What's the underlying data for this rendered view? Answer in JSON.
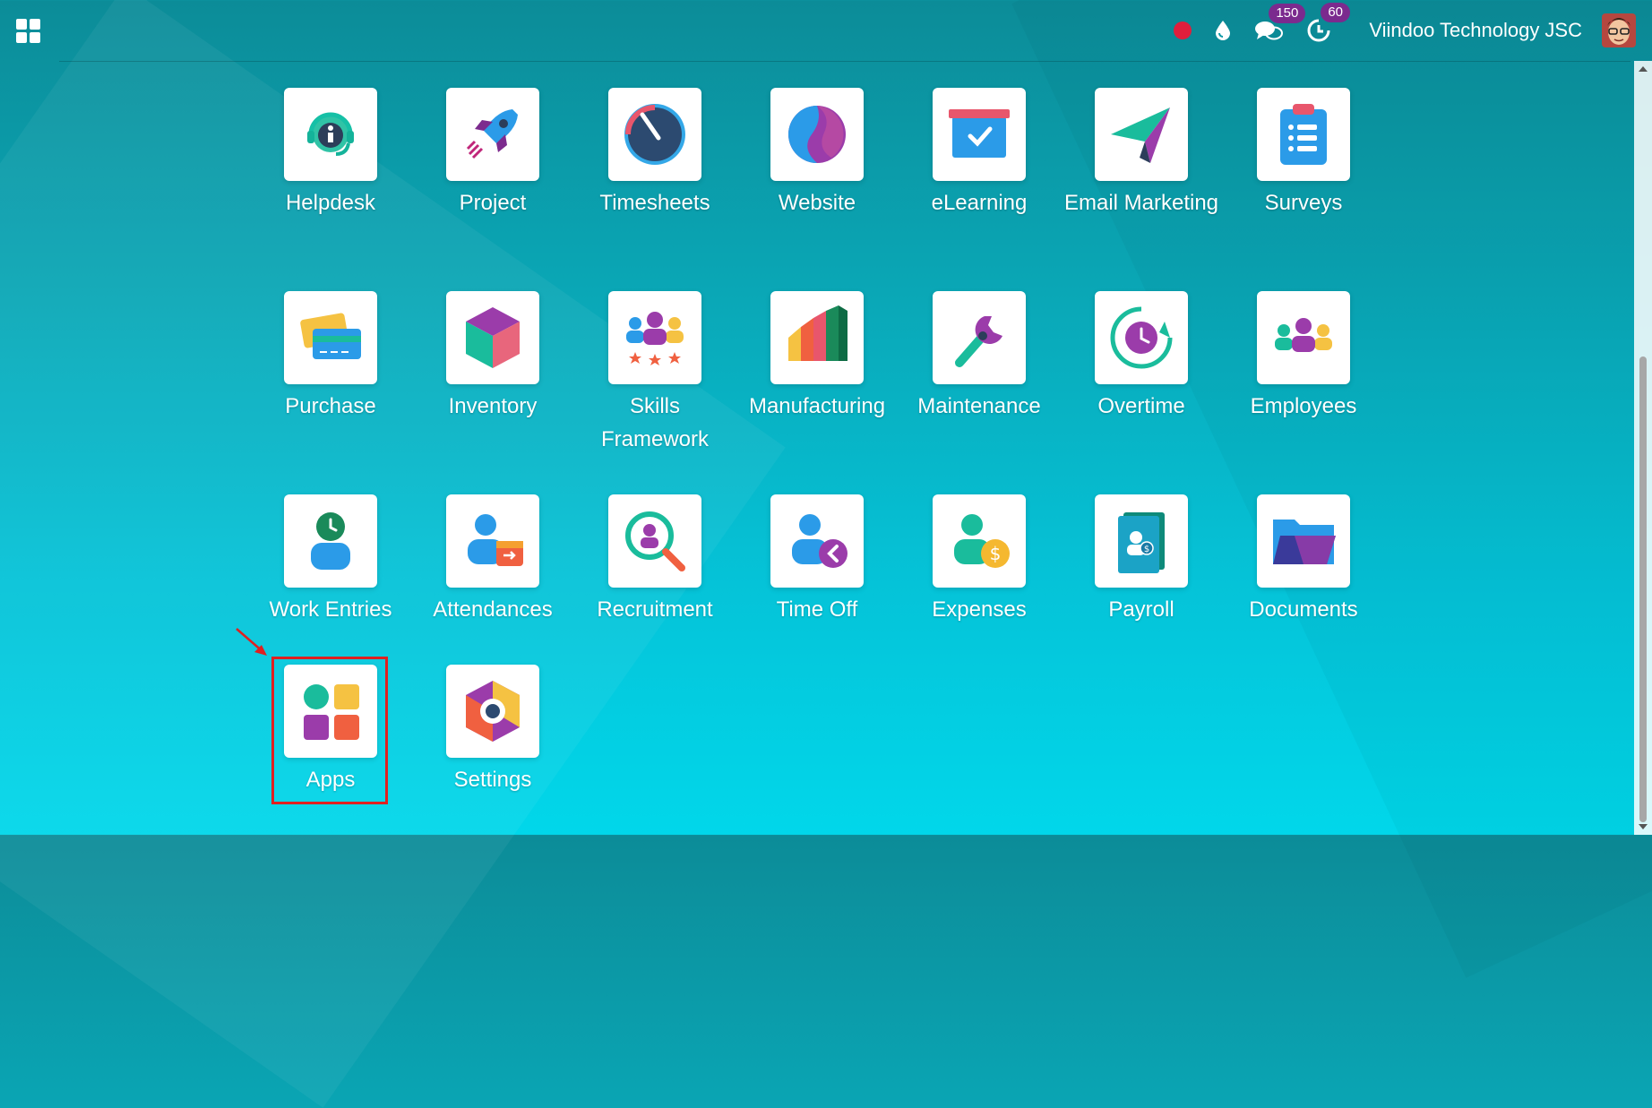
{
  "navbar": {
    "menu_icon": "apps-grid-icon",
    "record_icon": "record-dot-icon",
    "odoobot_icon": "droplet-icon",
    "messages": {
      "icon": "chat-bubbles-icon",
      "count": "150"
    },
    "activities": {
      "icon": "clock-icon",
      "count": "60"
    },
    "company": "Viindoo Technology JSC",
    "avatar_icon": "user-avatar-icon"
  },
  "colors": {
    "badge": "#7b2a8e",
    "record_dot": "#e01e3c",
    "highlight": "#e02020",
    "background_top": "#0c8c98",
    "background_bottom": "#01d7ea"
  },
  "apps": [
    {
      "label": "Helpdesk",
      "icon": "helpdesk-icon"
    },
    {
      "label": "Project",
      "icon": "rocket-icon"
    },
    {
      "label": "Timesheets",
      "icon": "gauge-icon"
    },
    {
      "label": "Website",
      "icon": "website-icon"
    },
    {
      "label": "eLearning",
      "icon": "elearning-icon"
    },
    {
      "label": "Email Marketing",
      "icon": "paper-plane-icon"
    },
    {
      "label": "Surveys",
      "icon": "clipboard-icon"
    },
    {
      "label": "Purchase",
      "icon": "credit-card-icon"
    },
    {
      "label": "Inventory",
      "icon": "cube-icon"
    },
    {
      "label": "Skills Framework",
      "icon": "skills-icon"
    },
    {
      "label": "Manufacturing",
      "icon": "factory-icon"
    },
    {
      "label": "Maintenance",
      "icon": "wrench-icon"
    },
    {
      "label": "Overtime",
      "icon": "overtime-clock-icon"
    },
    {
      "label": "Employees",
      "icon": "people-icon"
    },
    {
      "label": "Work Entries",
      "icon": "work-entries-icon"
    },
    {
      "label": "Attendances",
      "icon": "attendance-icon"
    },
    {
      "label": "Recruitment",
      "icon": "magnifier-person-icon"
    },
    {
      "label": "Time Off",
      "icon": "time-off-icon"
    },
    {
      "label": "Expenses",
      "icon": "expenses-icon"
    },
    {
      "label": "Payroll",
      "icon": "payroll-icon"
    },
    {
      "label": "Documents",
      "icon": "folder-icon"
    },
    {
      "label": "Apps",
      "icon": "apps-icon"
    },
    {
      "label": "Settings",
      "icon": "settings-icon"
    }
  ],
  "annotation": {
    "highlighted_app": "Apps"
  }
}
